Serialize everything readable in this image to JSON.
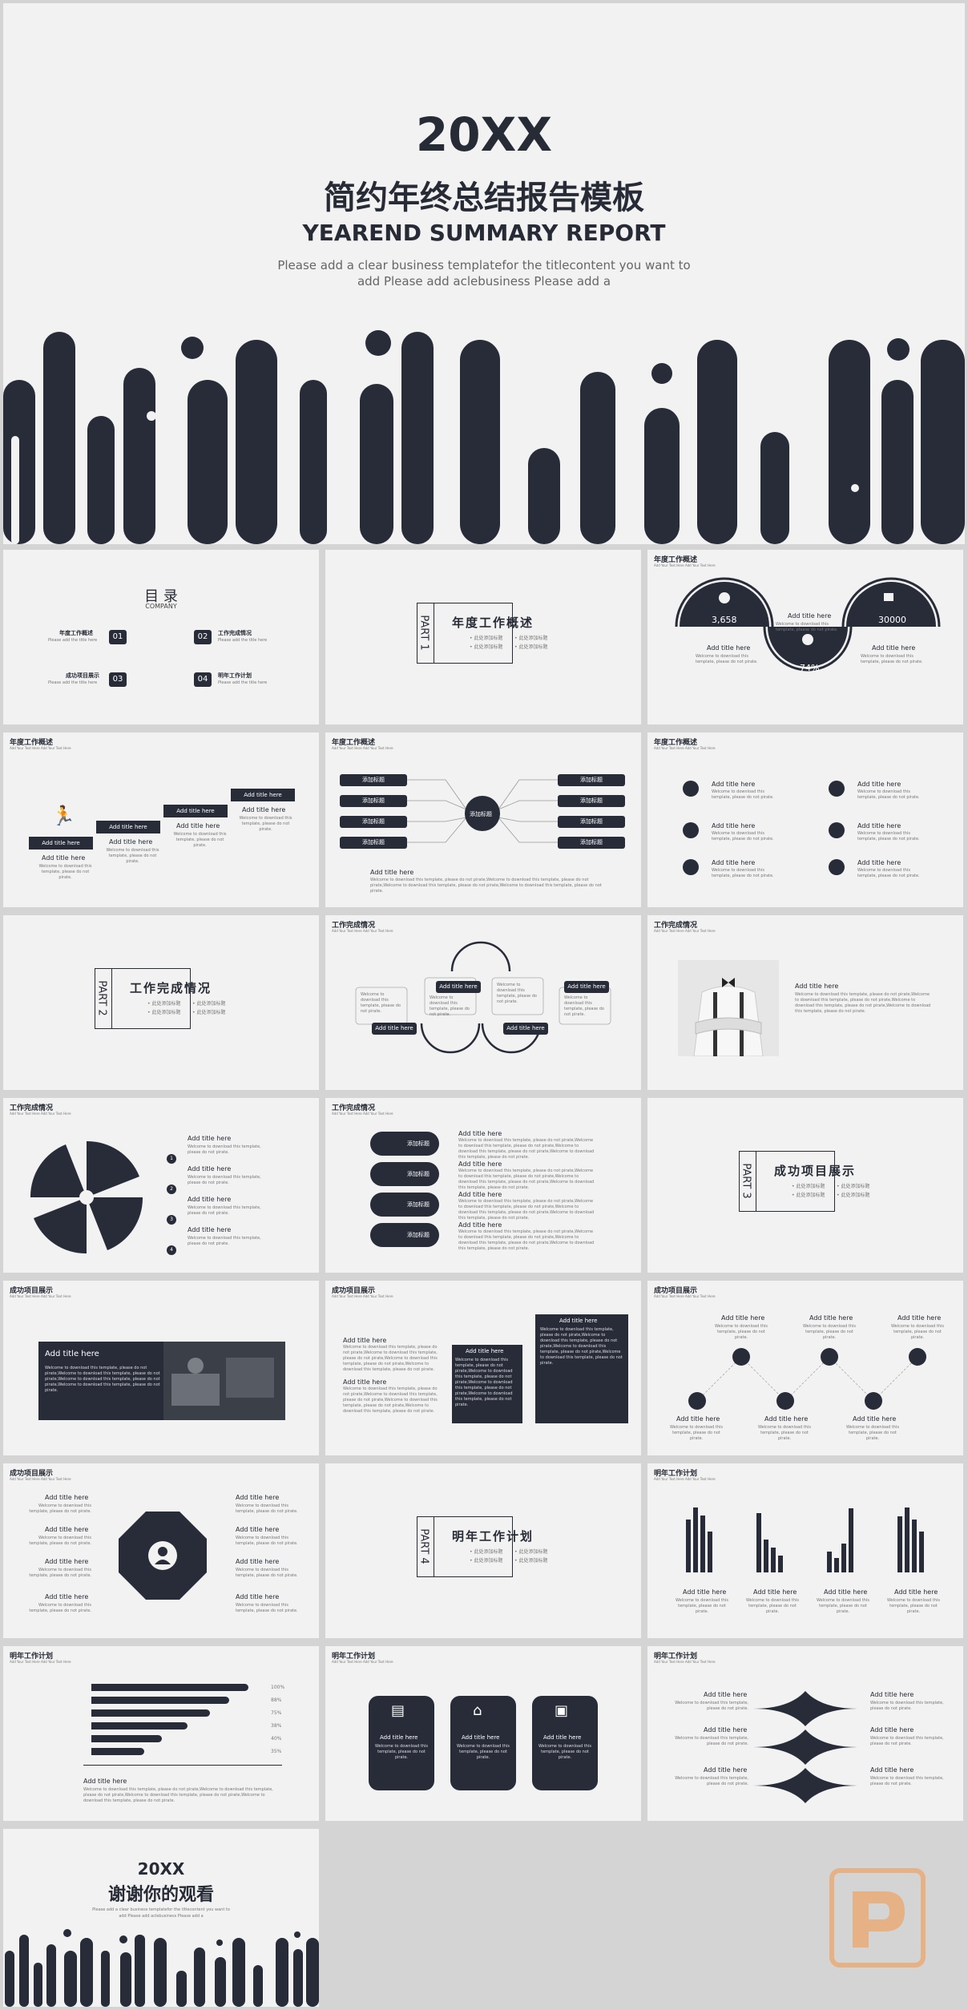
{
  "cover": {
    "year": "20XX",
    "title_cn": "简约年终总结报告模板",
    "title_en": "YEAREND SUMMARY REPORT",
    "sub1": "Please add a clear business templatefor the titlecontent you want to",
    "sub2": "add Please add aclebusiness Please add a"
  },
  "toc": {
    "title": "目 录",
    "company": "COMPANY",
    "items": [
      {
        "num": "01",
        "label": "年度工作概述",
        "sub": "Please add the title here"
      },
      {
        "num": "02",
        "label": "工作完成情况",
        "sub": "Please add the title here"
      },
      {
        "num": "03",
        "label": "成功项目展示",
        "sub": "Please add the title here"
      },
      {
        "num": "04",
        "label": "明年工作计划",
        "sub": "Please add the title here"
      }
    ]
  },
  "parts": [
    {
      "part": "PART 1",
      "title": "年度工作概述",
      "items": [
        "此处添加标题",
        "此处添加标题",
        "此处添加标题",
        "此处添加标题"
      ]
    },
    {
      "part": "PART 2",
      "title": "工作完成情况",
      "items": [
        "此处添加标题",
        "此处添加标题",
        "此处添加标题",
        "此处添加标题"
      ]
    },
    {
      "part": "PART 3",
      "title": "成功项目展示",
      "items": [
        "此处添加标题",
        "此处添加标题",
        "此处添加标题",
        "此处添加标题"
      ]
    },
    {
      "part": "PART 4",
      "title": "明年工作计划",
      "items": [
        "此处添加标题",
        "此处添加标题",
        "此处添加标题",
        "此处添加标题"
      ]
    }
  ],
  "common": {
    "hdr_sub": "Add Your Text Here Add Your Text Here",
    "add_title": "Add title here",
    "body_short": "Welcome to download this template, please do not pirate.",
    "body_long": "Welcome to download this template, please do not pirate,Welcome to download this template, please do not pirate,Welcome to download this template, please do not pirate,Welcome to download this template, please do not pirate.",
    "add_tag": "添加标题"
  },
  "headers": {
    "s1": "年度工作概述",
    "s2": "工作完成情况",
    "s3": "成功项目展示",
    "s4": "明年工作计划"
  },
  "stats": {
    "v1": "3,658",
    "v2": "74%",
    "v3": "30000"
  },
  "bars_pct": [
    "100%",
    "88%",
    "75%",
    "38%",
    "40%",
    "35%"
  ],
  "end": {
    "year": "20XX",
    "title": "谢谢你的观看",
    "sub1": "Please add a clear business templatefor the titlecontent you want to",
    "sub2": "add Please add aclebusiness Please add a"
  },
  "colors": {
    "dark": "#272c38",
    "bg": "#f2f2f2",
    "page": "#d4d4d5",
    "watermark": "#e9a870"
  }
}
